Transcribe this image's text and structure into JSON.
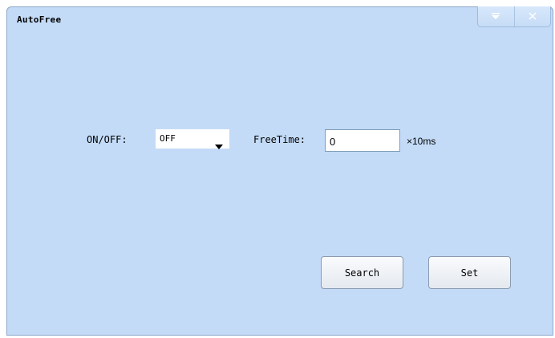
{
  "window": {
    "title": "AutoFree"
  },
  "title_buttons": {
    "menu_icon": "dropdown-menu-icon",
    "close_icon": "close-icon"
  },
  "form": {
    "onoff_label": "ON/OFF:",
    "onoff_value": "OFF",
    "freetime_label": "FreeTime:",
    "freetime_value": "0",
    "freetime_unit": "×10ms"
  },
  "buttons": {
    "search_label": "Search",
    "set_label": "Set"
  },
  "colors": {
    "window_bg": "#c3dbf7",
    "border": "#8ea8c8"
  }
}
